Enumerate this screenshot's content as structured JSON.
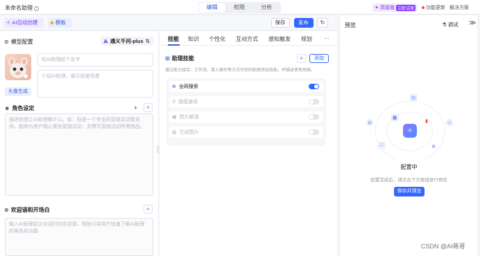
{
  "header": {
    "app_title": "未命名助理",
    "tabs": [
      {
        "label": "编辑",
        "active": true
      },
      {
        "label": "权限",
        "active": false
      },
      {
        "label": "分析",
        "active": false
      }
    ],
    "advanced_label": "高级版",
    "advanced_badge": "立即试用",
    "update_label": "功能更新",
    "solutions_label": "解决方案"
  },
  "toolbar": {
    "ai_create_label": "AI自动创建",
    "template_label": "模板",
    "save_label": "保存",
    "publish_label": "发布"
  },
  "left": {
    "model_config_label": "模型配置",
    "model_name": "通义千问-plus",
    "avatar_gen_label": "头像生成",
    "name_placeholder": "给AI助理起个名字",
    "desc_placeholder": "介绍AI助理，展示给使用者",
    "role_label": "角色设定",
    "role_placeholder": "描述你想让AI助理做什么。如：你是一个专业的营销活动策划师，能够为用户精心策划营销活动，并撰写营销活动所需物品。",
    "welcome_label": "欢迎语和开场白",
    "welcome_placeholder": "输入AI助理初次对话时的欢迎语，帮助引导用户快速了解AI助理的角色和功能"
  },
  "middle": {
    "tabs": [
      "技能",
      "知识",
      "个性化",
      "互动方式",
      "感知触发",
      "规划"
    ],
    "more_label": "···",
    "plugin_label": "助理技能",
    "plugin_desc": "通过能力组合、工作流、接入操作等方式为你的助理添加技能，并描述使用场景。",
    "add_label": "添加",
    "skills": [
      {
        "label": "全网搜索",
        "enabled": true,
        "icon": "globe-icon"
      },
      {
        "label": "链接速读",
        "enabled": false,
        "icon": "link-icon"
      },
      {
        "label": "图片解读",
        "enabled": false,
        "icon": "image-icon"
      },
      {
        "label": "生成图片",
        "enabled": false,
        "icon": "image-gen-icon"
      }
    ]
  },
  "right": {
    "title": "预览",
    "debug_label": "调试",
    "collapse_label": "≫",
    "config_title": "配置中",
    "config_sub": "配置完成后，请点击下方按钮进行预览",
    "save_preview_label": "保存并预览"
  },
  "watermark": "CSDN @AI蒋哥",
  "colors": {
    "accent": "#3366ff",
    "purple": "#7b3fe4"
  }
}
